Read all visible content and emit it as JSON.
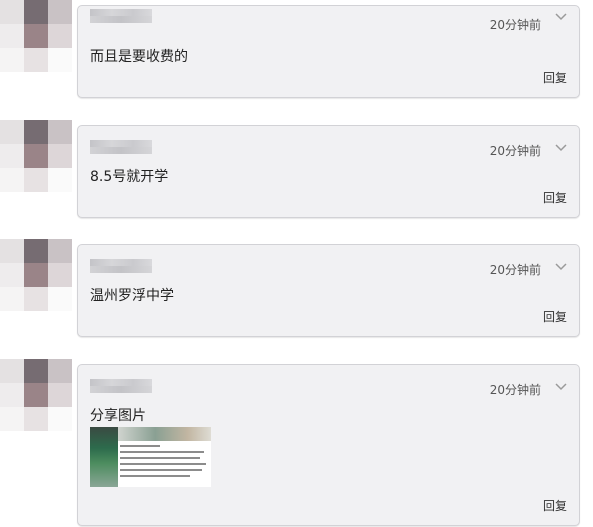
{
  "comments": [
    {
      "time": "20分钟前",
      "text": "而且是要收费的",
      "reply": "回复"
    },
    {
      "time": "20分钟前",
      "text": "8.5号就开学",
      "reply": "回复"
    },
    {
      "time": "20分钟前",
      "text": "温州罗浮中学",
      "reply": "回复"
    },
    {
      "time": "20分钟前",
      "text": "分享图片",
      "reply": "回复",
      "shared_image": true
    }
  ],
  "icons": {
    "expand": "chevron-down-icon"
  },
  "colors": {
    "card_background": "#f1f1f3",
    "card_border": "#d2d2d6",
    "text": "#222222"
  }
}
